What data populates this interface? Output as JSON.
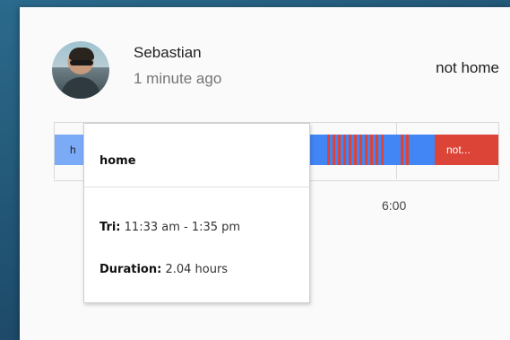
{
  "person": {
    "name": "Sebastian",
    "last_changed": "1 minute ago",
    "state": "not home"
  },
  "timeline": {
    "bar_labels": {
      "start": "h",
      "end": "not..."
    },
    "axis_tick": "6:00",
    "colors": {
      "home": "#4285f4",
      "home_light": "#7baaf7",
      "not_home": "#db4437"
    }
  },
  "tooltip": {
    "title": "home",
    "day_label": "Tri:",
    "range": "11:33 am - 1:35 pm",
    "duration_label": "Duration:",
    "duration": "2.04 hours"
  }
}
